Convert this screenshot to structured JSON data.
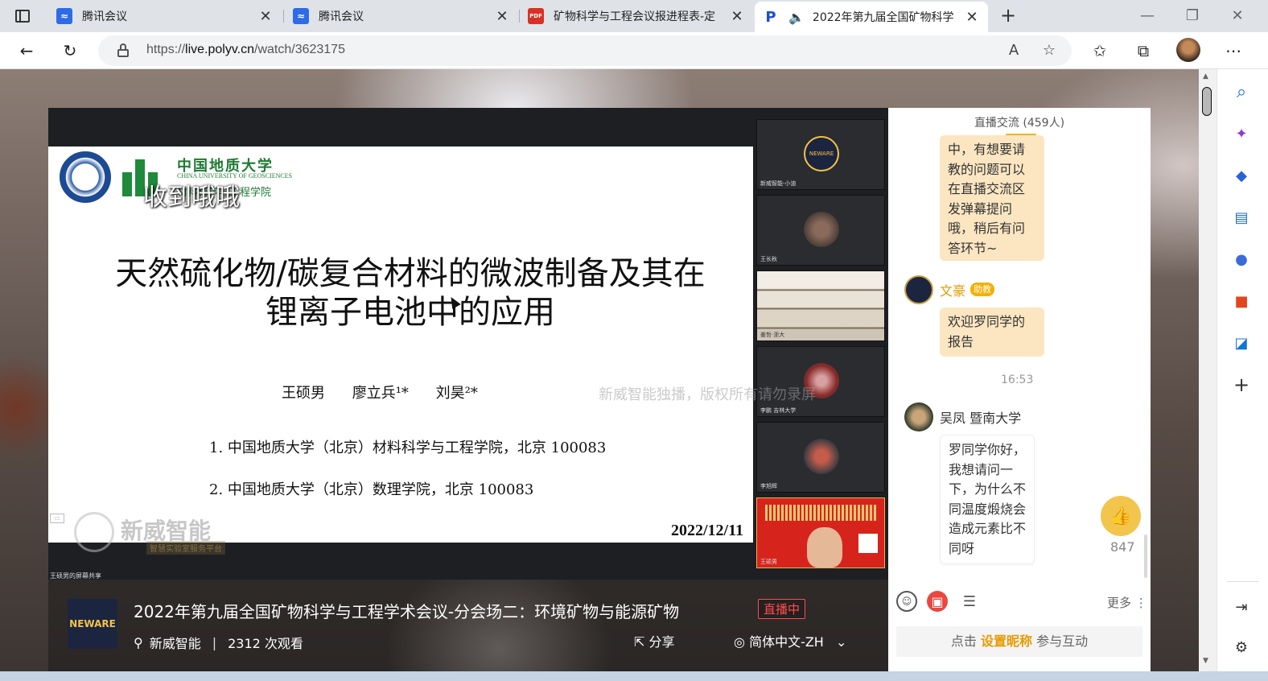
{
  "tabs": [
    {
      "title": "腾讯会议",
      "favicon": "tencent-meeting-icon"
    },
    {
      "title": "腾讯会议",
      "favicon": "tencent-meeting-icon"
    },
    {
      "title": "矿物科学与工程会议报进程表-定",
      "favicon": "pdf-icon",
      "favicon_text": "PDF"
    },
    {
      "title": "2022年第九届全国矿物科学",
      "favicon": "polyv-icon",
      "favicon_text": "P",
      "active": true
    }
  ],
  "address_bar": {
    "url_prefix": "https://",
    "url_host": "live.polyv.cn",
    "url_path": "/watch/3623175"
  },
  "slide": {
    "danmaku": "收到哦哦",
    "uni_cn": "中国地质大学",
    "uni_en": "CHINA UNIVERSITY OF GEOSCIENCES",
    "uni_sub": "材料科学与工程学院",
    "title_line1": "天然硫化物/碳复合材料的微波制备及其在",
    "title_line2": "锂离子电池中的应用",
    "authors": "王硕男 廖立兵¹* 刘昊²*",
    "affiliation1": "1. 中国地质大学（北京）材料科学与工程学院，北京 100083",
    "affiliation2": "2. 中国地质大学（北京）数理学院，北京 100083",
    "date": "2022/12/11",
    "watermark": "新威智能独播，版权所有请勿录屏",
    "brand_name": "新威智能",
    "brand_sub": "智慧实验室服务平台",
    "brand_logo": "NEWARE",
    "screenshare_label": "王硕男的屏幕共享"
  },
  "thumbnails": [
    {
      "label": "新威智能-小迪",
      "logo": "NEWARE"
    },
    {
      "label": "王长秋"
    },
    {
      "label": "姜哲·浙大"
    },
    {
      "label": "李鹏 吉林大学"
    },
    {
      "label": "李旭辉"
    },
    {
      "label": "王硕男"
    }
  ],
  "info": {
    "logo": "NEWARE",
    "title": "2022年第九届全国矿物科学与工程学术会议-分会场二：环境矿物与能源矿物",
    "live_badge": "直播中",
    "channel": "新威智能",
    "views": "2312 次观看",
    "share": "分享",
    "language": "简体中文-ZH"
  },
  "chat": {
    "header": "直播交流 (459人)",
    "msg1": "中，有想要请教的问题可以在直播交流区发弹幕提问哦，稍后有问答环节~",
    "assistant_name": "文豪",
    "assistant_tag": "助教",
    "msg2": "欢迎罗同学的报告",
    "time": "16:53",
    "user_name": "吴凤 暨南大学",
    "msg3": "罗同学你好，我想请问一下，为什么不同温度煅烧会造成元素比不同呀",
    "like_count": "847",
    "more": "更多",
    "input_prefix": "点击",
    "input_link": "设置昵称",
    "input_suffix": "参与互动"
  },
  "colors": {
    "accent": "#f5b31b",
    "live_red": "#ff4d4d",
    "bubble": "#fbe6c1"
  }
}
